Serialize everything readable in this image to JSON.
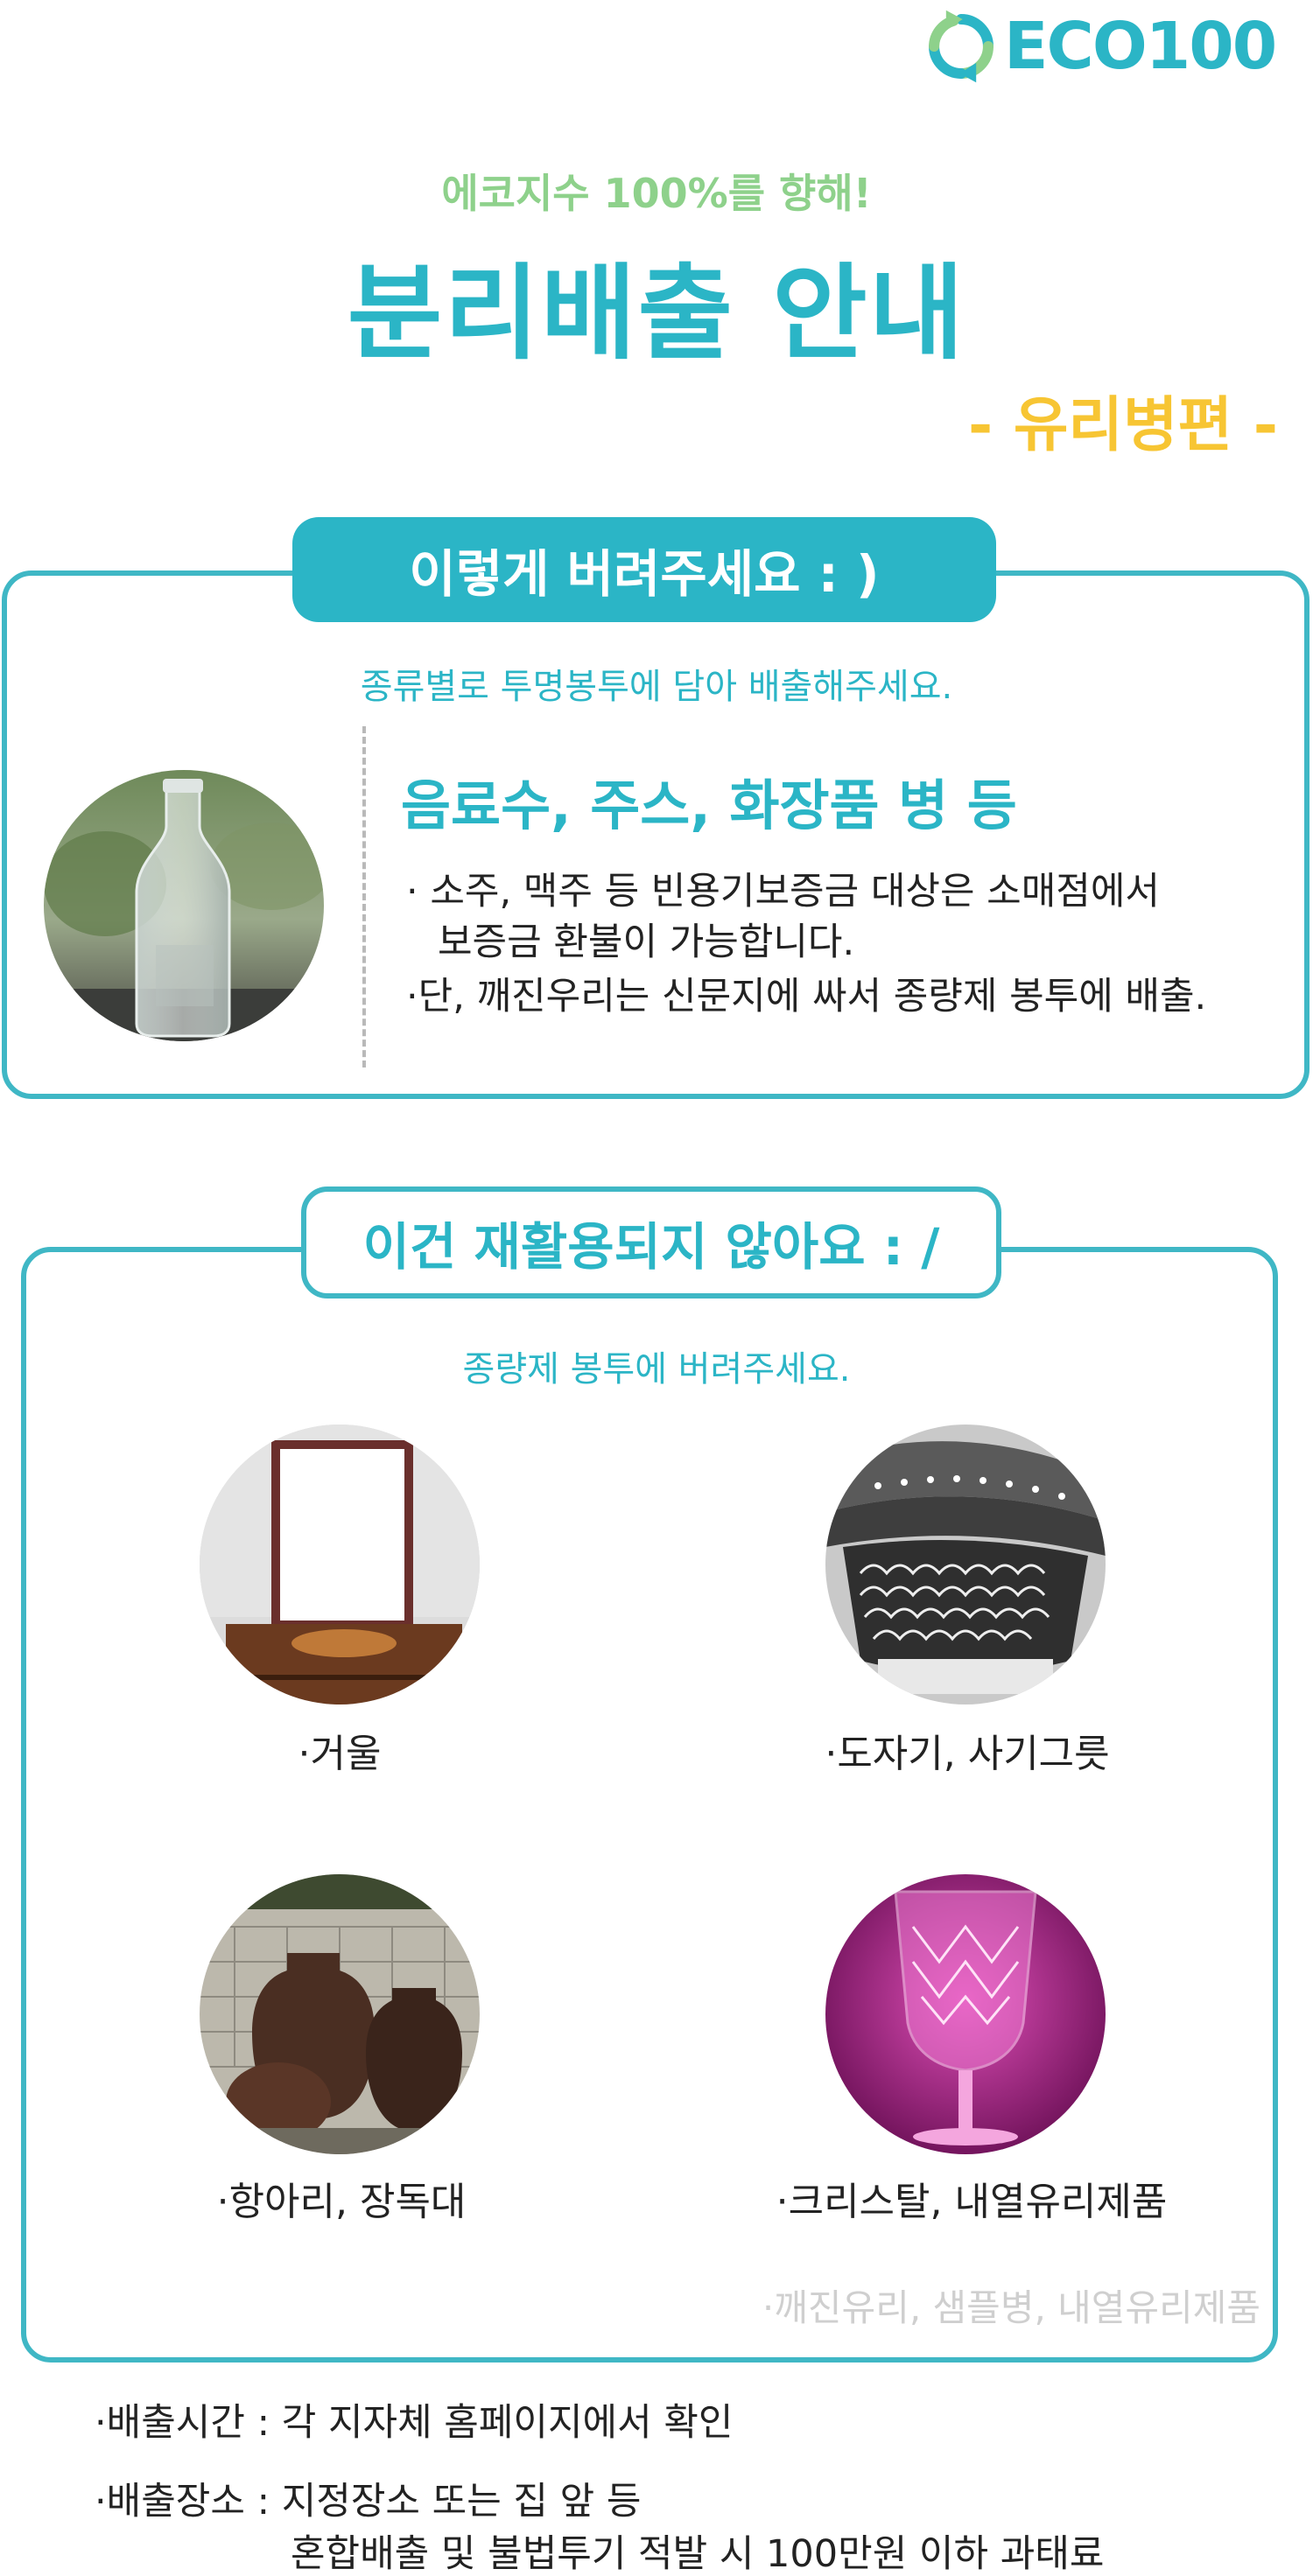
{
  "brand": {
    "name": "ECO100",
    "icon": "recycle-arrows-icon",
    "colors": {
      "teal": "#2bb5c6",
      "green": "#8ed18b",
      "yellow": "#f7c533"
    }
  },
  "header": {
    "eyebrow": "에코지수 100%를 향해!",
    "title": "분리배출 안내",
    "subtitle": "- 유리병편 -"
  },
  "how_to": {
    "pill": "이렇게 버려주세요 : )",
    "note": "종류별로 투명봉투에 담아 배출해주세요.",
    "heading": "음료수, 주스, 화장품 병 등",
    "bullets": [
      "· 소주, 맥주 등 빈용기보증금 대상은 소매점에서",
      "보증금 환불이 가능합니다.",
      "·단, 깨진우리는 신문지에 싸서 종량제 봉투에 배출."
    ]
  },
  "not_recyclable": {
    "pill": "이건 재활용되지 않아요 : /",
    "note": "종량제 봉투에 버려주세요.",
    "items": [
      {
        "label": "·거울",
        "icon": "mirror-photo"
      },
      {
        "label": "·도자기, 사기그릇",
        "icon": "ceramic-bowls-photo"
      },
      {
        "label": "·항아리, 장독대",
        "icon": "crocks-photo"
      },
      {
        "label": "·크리스탈, 내열유리제품",
        "icon": "crystal-glass-photo"
      }
    ],
    "faded_note": "·깨진유리, 샘플병, 내열유리제품"
  },
  "footer": {
    "time": "·배출시간 : 각 지자체 홈페이지에서 확인",
    "place": "·배출장소 : 지정장소 또는 집 앞 등",
    "penalty": "혼합배출 및 불법투기 적발 시 100만원 이하 과태료"
  }
}
